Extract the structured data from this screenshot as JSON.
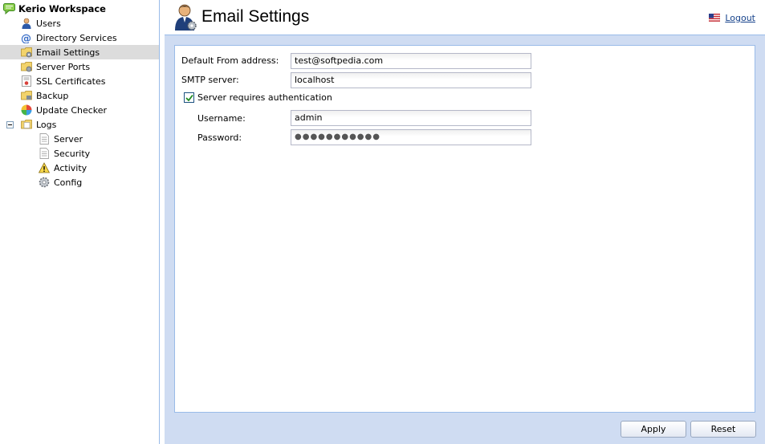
{
  "sidebar": {
    "root_label": "Kerio Workspace",
    "items": [
      {
        "label": "Users",
        "icon": "user-icon"
      },
      {
        "label": "Directory Services",
        "icon": "at-sign-icon"
      },
      {
        "label": "Email Settings",
        "icon": "email-settings-icon",
        "selected": true
      },
      {
        "label": "Server Ports",
        "icon": "server-ports-icon"
      },
      {
        "label": "SSL Certificates",
        "icon": "certificate-icon"
      },
      {
        "label": "Backup",
        "icon": "backup-folder-icon"
      },
      {
        "label": "Update Checker",
        "icon": "update-checker-icon"
      },
      {
        "label": "Logs",
        "icon": "logs-folder-icon",
        "expanded": true
      }
    ],
    "logs_children": [
      {
        "label": "Server",
        "icon": "log-page-icon"
      },
      {
        "label": "Security",
        "icon": "log-page-icon"
      },
      {
        "label": "Activity",
        "icon": "warning-icon"
      },
      {
        "label": "Config",
        "icon": "config-gear-icon"
      }
    ]
  },
  "header": {
    "title": "Email Settings",
    "logout_label": "Logout"
  },
  "form": {
    "default_from_label": "Default From address:",
    "default_from_value": "test@softpedia.com",
    "smtp_label": "SMTP server:",
    "smtp_value": "localhost",
    "auth_label": "Server requires authentication",
    "auth_checked": true,
    "username_label": "Username:",
    "username_value": "admin",
    "password_label": "Password:",
    "password_mask": "●●●●●●●●●●●"
  },
  "buttons": {
    "apply": "Apply",
    "reset": "Reset"
  },
  "colors": {
    "panel_border": "#99bbe8",
    "main_background": "#cfdcf2",
    "selected_row": "#dcdcdc",
    "link": "#15428b"
  }
}
